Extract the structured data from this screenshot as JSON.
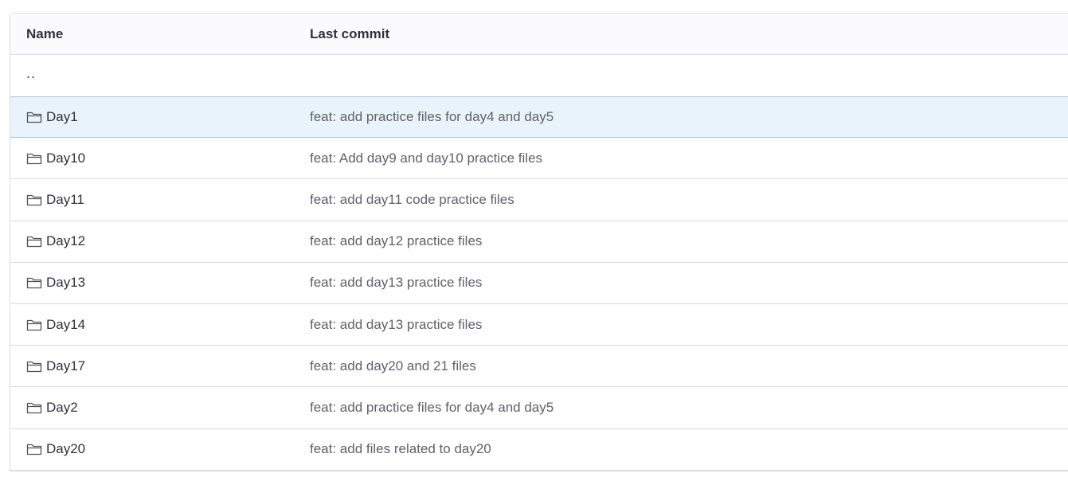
{
  "table": {
    "header": {
      "name_label": "Name",
      "commit_label": "Last commit"
    },
    "parent_label": "..",
    "rows": [
      {
        "name": "Day1",
        "commit": "feat: add practice files for day4 and day5",
        "highlighted": true
      },
      {
        "name": "Day10",
        "commit": "feat: Add day9 and day10 practice files"
      },
      {
        "name": "Day11",
        "commit": "feat: add day11 code practice files"
      },
      {
        "name": "Day12",
        "commit": "feat: add day12 practice files"
      },
      {
        "name": "Day13",
        "commit": "feat: add day13 practice files"
      },
      {
        "name": "Day14",
        "commit": "feat: add day13 practice files"
      },
      {
        "name": "Day17",
        "commit": "feat: add day20 and 21 files"
      },
      {
        "name": "Day2",
        "commit": "feat: add practice files for day4 and day5"
      },
      {
        "name": "Day20",
        "commit": "feat: add files related to day20"
      }
    ],
    "icon": "folder-icon",
    "colors": {
      "highlight_bg": "#e9f3fc",
      "highlight_border": "#a4c8ea",
      "border": "#dcdcde",
      "header_bg": "#fbfafd"
    }
  }
}
